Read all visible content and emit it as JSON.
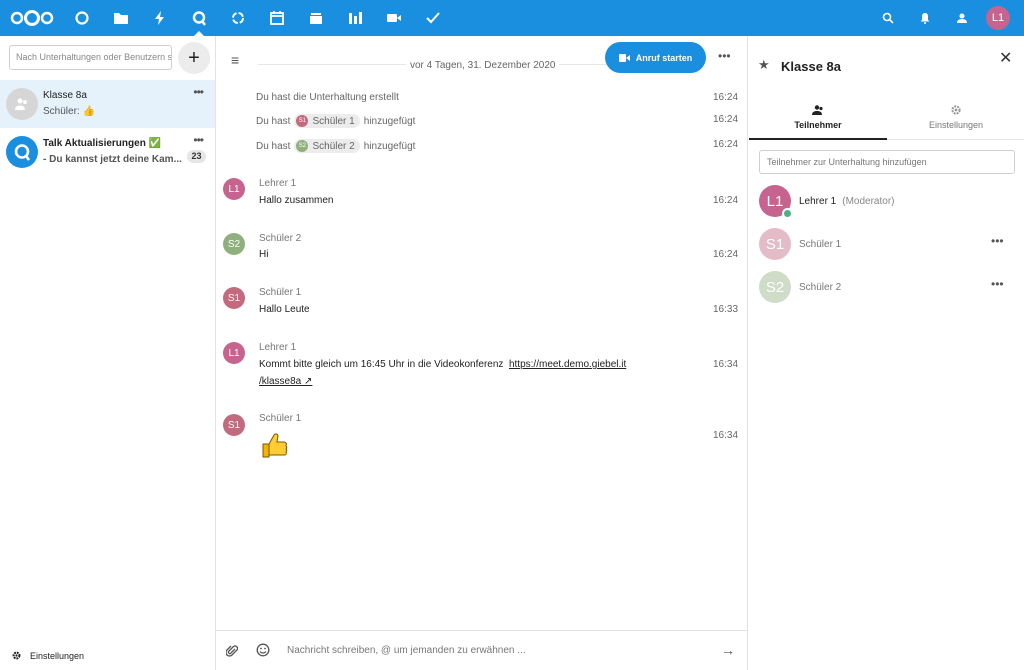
{
  "topbar": {
    "apps": [
      "dashboard-icon",
      "files-icon",
      "activity-icon",
      "talk-icon",
      "sync-icon",
      "calendar-icon",
      "deck-icon",
      "analytics-icon",
      "video-icon",
      "tasks-icon"
    ],
    "user_initials": "L1",
    "accent_color": "#1a8fe0"
  },
  "leftnav": {
    "search_placeholder": "Nach Unterhaltungen oder Benutzern suchen",
    "conversations": [
      {
        "title": "Klasse 8a",
        "subtitle": "Schüler: 👍"
      },
      {
        "title": "Talk Aktualisierungen ✅",
        "subtitle": "- Du kannst jetzt deine Kam...",
        "badge": "23"
      }
    ],
    "settings_label": "Einstellungen"
  },
  "chat": {
    "date_label": "vor 4 Tagen, 31. Dezember 2020",
    "call_button": "Anruf starten",
    "system_messages": [
      {
        "before": "Du hast die Unterhaltung erstellt",
        "time": "16:24"
      },
      {
        "before": "Du hast",
        "chip": "Schüler 1",
        "chip_initials": "S1",
        "after": "hinzugefügt",
        "time": "16:24"
      },
      {
        "before": "Du hast",
        "chip": "Schüler 2",
        "chip_initials": "S2",
        "after": "hinzugefügt",
        "time": "16:24"
      }
    ],
    "messages": [
      {
        "author": "Lehrer 1",
        "initials": "L1",
        "text": "Hallo zusammen",
        "time": "16:24"
      },
      {
        "author": "Schüler 2",
        "initials": "S2",
        "text": "Hi",
        "time": "16:24"
      },
      {
        "author": "Schüler 1",
        "initials": "S1",
        "text": "Hallo Leute",
        "time": "16:33"
      },
      {
        "author": "Lehrer 1",
        "initials": "L1",
        "text": "Kommt bitte gleich um 16:45 Uhr in die Videokonferenz",
        "link_part1": "https://meet.demo.giebel.it",
        "link_part2": "/klasse8a ↗",
        "time": "16:34"
      },
      {
        "author": "Schüler 1",
        "initials": "S1",
        "text": "👍",
        "time": "16:34"
      }
    ],
    "composer_placeholder": "Nachricht schreiben, @ um jemanden zu erwähnen ..."
  },
  "rightbar": {
    "title": "Klasse 8a",
    "tabs": [
      "Teilnehmer",
      "Einstellungen"
    ],
    "add_placeholder": "Teilnehmer zur Unterhaltung hinzufügen",
    "participants": [
      {
        "initials": "L1",
        "name": "Lehrer 1",
        "role": "(Moderator)"
      },
      {
        "initials": "S1",
        "name": "Schüler 1"
      },
      {
        "initials": "S2",
        "name": "Schüler 2"
      }
    ]
  },
  "colors": {
    "lehrer": "#c7638f",
    "schueler1": "#c46a7e",
    "schueler2": "#8fb07d",
    "online": "#49b382"
  }
}
